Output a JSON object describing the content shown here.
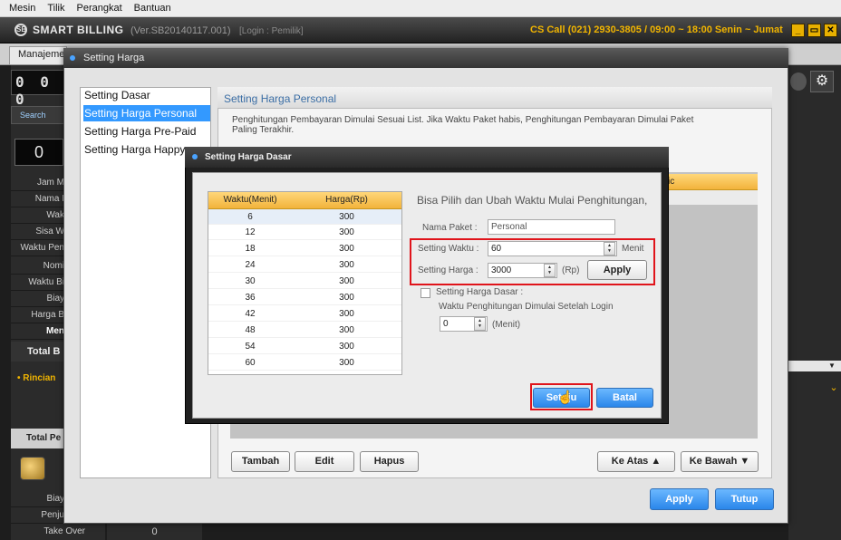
{
  "menubar": [
    "Mesin",
    "Tilik",
    "Perangkat",
    "Bantuan"
  ],
  "app": {
    "logo": "SB",
    "name": "SMART BILLING",
    "version": "(Ver.SB20140117.001)",
    "login": "[Login : Pemilik]",
    "cs_info": "CS Call (021) 2930-3805 / 09:00 ~ 18:00 Senin ~ Jumat",
    "window_buttons": [
      "_",
      "▭",
      "✕"
    ]
  },
  "main_tab": "Manajemen",
  "background": {
    "counter": "0 0 0",
    "search_tab": "Search",
    "zero_value": "0",
    "rows": [
      "Jam M",
      "Nama I",
      "Wak",
      "Sisa W",
      "Waktu Pen",
      "Nomi",
      "Waktu Bi",
      "Biay",
      "Harga B",
      "Men"
    ],
    "total_b": "Total B",
    "rincian": "• Rincian",
    "total_pe": "Total Pe",
    "bottom_rows": [
      "Biay",
      "Penju"
    ],
    "take_over_label": "Take Over",
    "take_over_value": "0",
    "gear_icon": "⚙"
  },
  "setting_harga": {
    "title": "Setting Harga",
    "menu": [
      "Setting Dasar",
      "Setting Harga Personal",
      "Setting Harga Pre-Paid",
      "Setting Harga Happy H"
    ],
    "selected_menu_index": 1,
    "panel_title": "Setting Harga Personal",
    "description": "Penghitungan Pembayaran Dimulai Sesuai List. Jika Waktu Paket habis, Penghitungan Pembayaran Dimulai Paket Paling Terakhir.",
    "table_head_partial": "ic",
    "buttons": {
      "tambah": "Tambah",
      "edit": "Edit",
      "hapus": "Hapus",
      "ke_atas": "Ke Atas ▲",
      "ke_bawah": "Ke Bawah ▼",
      "apply": "Apply",
      "tutup": "Tutup"
    }
  },
  "setting_harga_dasar": {
    "title": "Setting Harga Dasar",
    "columns": [
      "Waktu(Menit)",
      "Harga(Rp)"
    ],
    "rows": [
      [
        "6",
        "300"
      ],
      [
        "12",
        "300"
      ],
      [
        "18",
        "300"
      ],
      [
        "24",
        "300"
      ],
      [
        "30",
        "300"
      ],
      [
        "36",
        "300"
      ],
      [
        "42",
        "300"
      ],
      [
        "48",
        "300"
      ],
      [
        "54",
        "300"
      ],
      [
        "60",
        "300"
      ]
    ],
    "info": "Bisa Pilih dan Ubah Waktu Mulai Penghitungan,",
    "nama_paket_label": "Nama Paket :",
    "nama_paket_value": "Personal",
    "setting_waktu_label": "Setting Waktu :",
    "setting_waktu_value": "60",
    "setting_waktu_unit": "Menit",
    "setting_harga_label": "Setting Harga :",
    "setting_harga_value": "3000",
    "setting_harga_unit": "(Rp)",
    "apply": "Apply",
    "checkbox_label": "Setting Harga Dasar :",
    "checkbox_checked": false,
    "login_label": "Waktu Penghitungan Dimulai Setelah Login",
    "login_value": "0",
    "login_unit": "(Menit)",
    "setuju": "Setuju",
    "batal": "Batal"
  }
}
